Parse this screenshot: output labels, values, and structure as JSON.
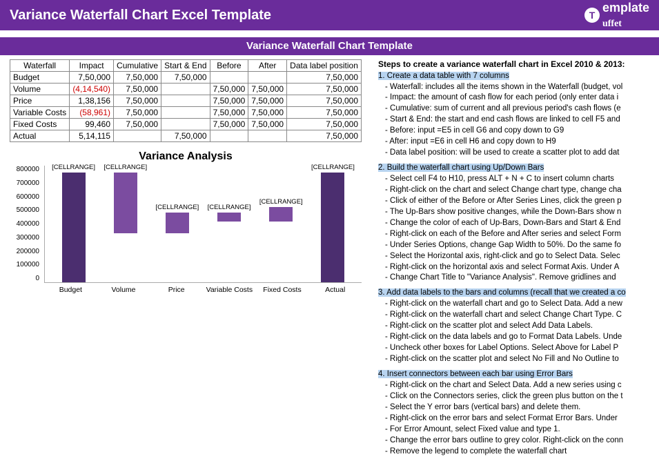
{
  "header": {
    "title": "Variance Waterfall Chart Excel Template",
    "logo_text": "emplate",
    "logo_text2": "uffet"
  },
  "subheader": "Variance Waterfall Chart Template",
  "table": {
    "headers": [
      "Waterfall",
      "Impact",
      "Cumulative",
      "Start & End",
      "Before",
      "After",
      "Data label position"
    ],
    "rows": [
      {
        "label": "Budget",
        "impact": "7,50,000",
        "cumulative": "7,50,000",
        "startend": "7,50,000",
        "before": "",
        "after": "",
        "dlp": "7,50,000"
      },
      {
        "label": "Volume",
        "impact": "(4,14,540)",
        "impact_neg": true,
        "cumulative": "7,50,000",
        "startend": "",
        "before": "7,50,000",
        "after": "7,50,000",
        "dlp": "7,50,000"
      },
      {
        "label": "Price",
        "impact": "1,38,156",
        "cumulative": "7,50,000",
        "startend": "",
        "before": "7,50,000",
        "after": "7,50,000",
        "dlp": "7,50,000"
      },
      {
        "label": "Variable Costs",
        "impact": "(58,961)",
        "impact_neg": true,
        "cumulative": "7,50,000",
        "startend": "",
        "before": "7,50,000",
        "after": "7,50,000",
        "dlp": "7,50,000"
      },
      {
        "label": "Fixed Costs",
        "impact": "99,460",
        "cumulative": "7,50,000",
        "startend": "",
        "before": "7,50,000",
        "after": "7,50,000",
        "dlp": "7,50,000"
      },
      {
        "label": "Actual",
        "impact": "5,14,115",
        "cumulative": "",
        "startend": "7,50,000",
        "before": "",
        "after": "",
        "dlp": "7,50,000"
      }
    ]
  },
  "chart_data": {
    "type": "bar",
    "title": "Variance Analysis",
    "categories": [
      "Budget",
      "Volume",
      "Price",
      "Variable Costs",
      "Fixed Costs",
      "Actual"
    ],
    "series": [
      {
        "name": "Start & End",
        "values": [
          750000,
          null,
          null,
          null,
          null,
          750000
        ],
        "color": "#4b2e6f"
      },
      {
        "name": "Waterfall",
        "base": [
          0,
          335460,
          335460,
          414655,
          414655,
          0
        ],
        "height": [
          750000,
          414540,
          138156,
          58961,
          99460,
          750000
        ]
      }
    ],
    "ylim": [
      0,
      800000
    ],
    "yticks": [
      0,
      100000,
      200000,
      300000,
      400000,
      500000,
      600000,
      700000,
      800000
    ],
    "cell_label": "[CELLRANGE]",
    "xlabel": "",
    "ylabel": ""
  },
  "steps": {
    "title": "Steps to create a variance waterfall chart in Excel 2010 & 2013:",
    "s1_head": "1. Create a data table with 7 columns",
    "s1": [
      "- Waterfall: includes all the items shown in the Waterfall (budget, vol",
      "- Impact: the amount of cash flow for each period (only enter data i",
      "- Cumulative: sum of current and all previous period's cash flows (e",
      "- Start & End: the start and end cash flows are linked to cell F5 and",
      "- Before: input =E5 in cell G6 and copy down to G9",
      "- After: input =E6 in cell H6 and copy down to H9",
      "- Data label position: will be used to create a scatter plot to add dat"
    ],
    "s2_head": "2. Build the waterfall chart using Up/Down Bars",
    "s2": [
      "- Select cell F4 to H10, press ALT + N + C to insert column charts",
      "- Right-click on the chart and select Change chart type, change cha",
      "- Click of either of the Before or After Series Lines, click the green p",
      "- The Up-Bars show positive changes, while the Down-Bars show n",
      "- Change the color of each of Up-Bars, Down-Bars and Start & End",
      "- Right-click on each of the Before and After series and select Form",
      "- Under Series Options, change Gap Width to 50%. Do the same fo",
      "- Select the Horizontal axis, right-click and go to Select Data. Selec",
      "- Right-click on the horizontal axis and select Format Axis. Under A",
      "- Change Chart Title to \"Variance Analysis\". Remove gridlines and"
    ],
    "s3_head": "3. Add data labels to the bars and columns (recall that we created a co",
    "s3": [
      "- Right-click on the waterfall chart and go to Select Data. Add a new",
      "- Right-click on the waterfall chart and select Change Chart Type. C",
      "- Right-click on the scatter plot and select Add Data Labels.",
      "- Right-click on the data labels and go to Format Data Labels. Unde",
      "- Uncheck other boxes for Label Options. Select Above for Label P",
      "- Right-click on the scatter plot and select No Fill and No Outline to"
    ],
    "s4_head": "4. Insert connectors between each bar using Error Bars",
    "s4": [
      "- Right-click on the chart and Select Data. Add a new series using c",
      "- Click on the Connectors series, click the green plus button on the t",
      "- Select the Y error bars (vertical bars) and delete them.",
      "- Right-click on the error bars and select Format Error Bars. Under",
      "- For Error Amount, select Fixed value and type 1.",
      "- Change the error bars outline to grey color. Right-click on the conn",
      "- Remove the legend to complete the waterfall chart"
    ]
  }
}
